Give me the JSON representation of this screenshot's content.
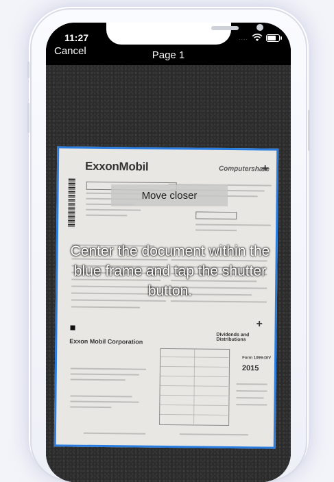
{
  "status_bar": {
    "time": "11:27",
    "signal": "....",
    "wifi": "wifi-icon",
    "battery": "battery-icon"
  },
  "nav": {
    "cancel_label": "Cancel",
    "title": "Page 1"
  },
  "document": {
    "brand": "ExxonMobil",
    "processor": "Computershare",
    "company_name": "Exxon Mobil Corporation",
    "section_heading": "Dividends and Distributions",
    "year": "2015",
    "form_label": "Form 1099-DIV"
  },
  "overlay": {
    "hint_badge": "Move closer",
    "instruction": "Center the document within the blue frame and tap the shutter button."
  },
  "colors": {
    "frame": "#2a7de0",
    "background": "#f3f4f9"
  }
}
